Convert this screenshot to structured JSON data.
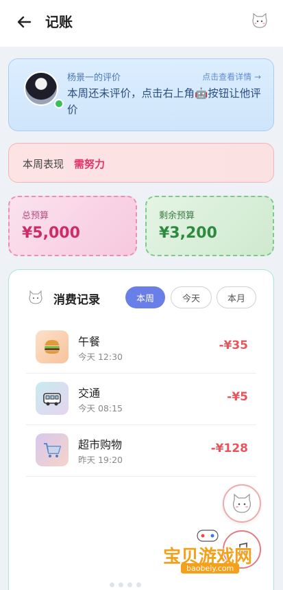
{
  "header": {
    "title": "记账"
  },
  "evaluation": {
    "name": "杨景一的评价",
    "link": "点击查看详情 →",
    "text": "本周还未评价，点击右上角🤖按钮让他评价"
  },
  "performance": {
    "label": "本周表现",
    "value": "需努力"
  },
  "budget": {
    "total_label": "总预算",
    "total_value": "¥5,000",
    "remain_label": "剩余预算",
    "remain_value": "¥3,200"
  },
  "records": {
    "title": "消费记录",
    "tabs": [
      "本周",
      "今天",
      "本月"
    ],
    "items": [
      {
        "name": "午餐",
        "time": "今天 12:30",
        "amount": "-¥35",
        "icon": "burger-icon"
      },
      {
        "name": "交通",
        "time": "今天 08:15",
        "amount": "-¥5",
        "icon": "bus-icon"
      },
      {
        "name": "超市购物",
        "time": "昨天 19:20",
        "amount": "-¥128",
        "icon": "cart-icon"
      }
    ]
  },
  "watermark": {
    "text": "宝贝游戏网",
    "url": "baobeiy.com"
  },
  "colors": {
    "accent": "#6a7ee8",
    "expense": "#e8545c",
    "warning": "#e0336a"
  }
}
